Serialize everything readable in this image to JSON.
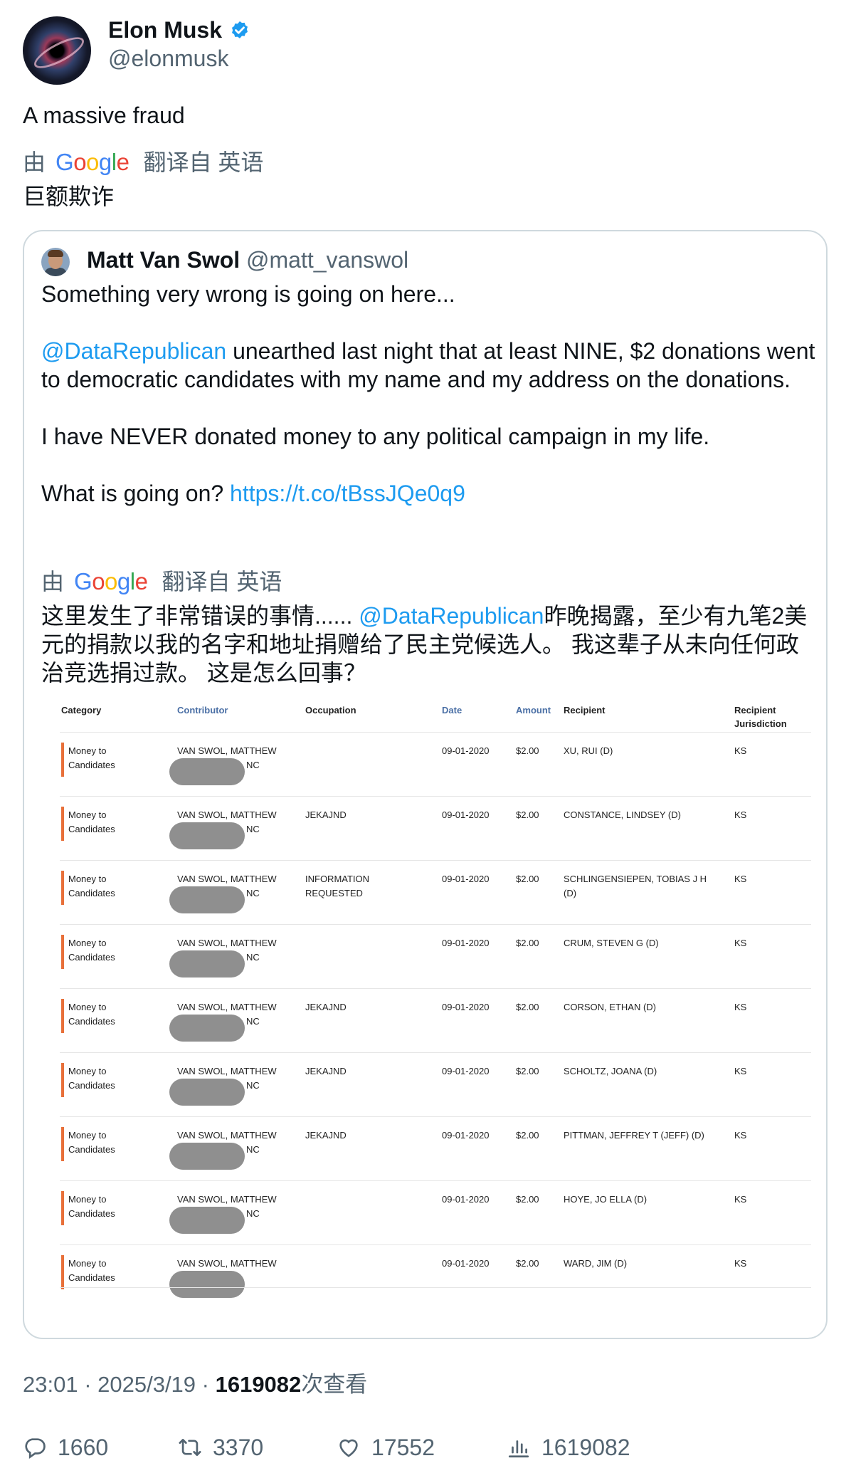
{
  "author": {
    "name": "Elon Musk",
    "handle": "@elonmusk"
  },
  "tweet": {
    "text": "A massive fraud",
    "translate": {
      "prefix": "由",
      "brand": "Google",
      "suffix": "翻译自 英语"
    },
    "translated_text": "巨额欺诈"
  },
  "quote": {
    "name": "Matt Van Swol",
    "handle": "@matt_vanswol",
    "line1": "Something very wrong is going on here...",
    "mention": "@DataRepublican",
    "line2": " unearthed last night that at least NINE, $2 donations went to democratic candidates with my name and my address on the donations.",
    "line3": "I have NEVER donated money to any political campaign in my life.",
    "line4_prefix": "What is going on? ",
    "link": "https://t.co/tBssJQe0q9",
    "translate": {
      "prefix": "由",
      "brand": "Google",
      "suffix": "翻译自 英语"
    },
    "translated_a": "这里发生了非常错误的事情...... ",
    "translated_mention": "@DataRepublican",
    "translated_b": "昨晚揭露，至少有九笔2美元的捐款以我的名字和地址捐赠给了民主党候选人。 我这辈子从未向任何政治竞选捐过款。 这是怎么回事？"
  },
  "table": {
    "headers": {
      "category": "Category",
      "contributor": "Contributor",
      "occupation": "Occupation",
      "date": "Date",
      "amount": "Amount",
      "recipient": "Recipient",
      "jurisdiction_1": "Recipient",
      "jurisdiction_2": "Jurisdiction"
    },
    "rows": [
      {
        "cat1": "Money to",
        "cat2": "Candidates",
        "contributor": "VAN SWOL, MATTHEW",
        "state": "NC",
        "occ1": "",
        "occ2": "",
        "date": "09-01-2020",
        "amount": "$2.00",
        "rec1": "XU, RUI (D)",
        "rec2": "",
        "jur": "KS"
      },
      {
        "cat1": "Money to",
        "cat2": "Candidates",
        "contributor": "VAN SWOL, MATTHEW",
        "state": "NC",
        "occ1": "JEKAJND",
        "occ2": "",
        "date": "09-01-2020",
        "amount": "$2.00",
        "rec1": "CONSTANCE, LINDSEY (D)",
        "rec2": "",
        "jur": "KS"
      },
      {
        "cat1": "Money to",
        "cat2": "Candidates",
        "contributor": "VAN SWOL, MATTHEW",
        "state": "NC",
        "occ1": "INFORMATION",
        "occ2": "REQUESTED",
        "date": "09-01-2020",
        "amount": "$2.00",
        "rec1": "SCHLINGENSIEPEN, TOBIAS J H",
        "rec2": "(D)",
        "jur": "KS"
      },
      {
        "cat1": "Money to",
        "cat2": "Candidates",
        "contributor": "VAN SWOL, MATTHEW",
        "state": "NC",
        "occ1": "",
        "occ2": "",
        "date": "09-01-2020",
        "amount": "$2.00",
        "rec1": "CRUM, STEVEN G (D)",
        "rec2": "",
        "jur": "KS"
      },
      {
        "cat1": "Money to",
        "cat2": "Candidates",
        "contributor": "VAN SWOL, MATTHEW",
        "state": "NC",
        "occ1": "JEKAJND",
        "occ2": "",
        "date": "09-01-2020",
        "amount": "$2.00",
        "rec1": "CORSON, ETHAN (D)",
        "rec2": "",
        "jur": "KS"
      },
      {
        "cat1": "Money to",
        "cat2": "Candidates",
        "contributor": "VAN SWOL, MATTHEW",
        "state": "NC",
        "occ1": "JEKAJND",
        "occ2": "",
        "date": "09-01-2020",
        "amount": "$2.00",
        "rec1": "SCHOLTZ, JOANA (D)",
        "rec2": "",
        "jur": "KS"
      },
      {
        "cat1": "Money to",
        "cat2": "Candidates",
        "contributor": "VAN SWOL, MATTHEW",
        "state": "NC",
        "occ1": "JEKAJND",
        "occ2": "",
        "date": "09-01-2020",
        "amount": "$2.00",
        "rec1": "PITTMAN, JEFFREY T (JEFF) (D)",
        "rec2": "",
        "jur": "KS"
      },
      {
        "cat1": "Money to",
        "cat2": "Candidates",
        "contributor": "VAN SWOL, MATTHEW",
        "state": "NC",
        "occ1": "",
        "occ2": "",
        "date": "09-01-2020",
        "amount": "$2.00",
        "rec1": "HOYE, JO ELLA (D)",
        "rec2": "",
        "jur": "KS"
      },
      {
        "cat1": "Money to",
        "cat2": "Candidates",
        "contributor": "VAN SWOL, MATTHEW",
        "state": "",
        "occ1": "",
        "occ2": "",
        "date": "09-01-2020",
        "amount": "$2.00",
        "rec1": "WARD, JIM (D)",
        "rec2": "",
        "jur": "KS"
      }
    ]
  },
  "footer": {
    "time": "23:01 · 2025/3/19 · ",
    "views_count": "1619082",
    "views_label": "次查看"
  },
  "stats": {
    "replies": "1660",
    "retweets": "3370",
    "likes": "17552",
    "views": "1619082"
  },
  "colors": {
    "link": "#1d9bf0",
    "verified": "#1d9bf0",
    "muted": "#536471",
    "category_bar": "#e8703a"
  }
}
